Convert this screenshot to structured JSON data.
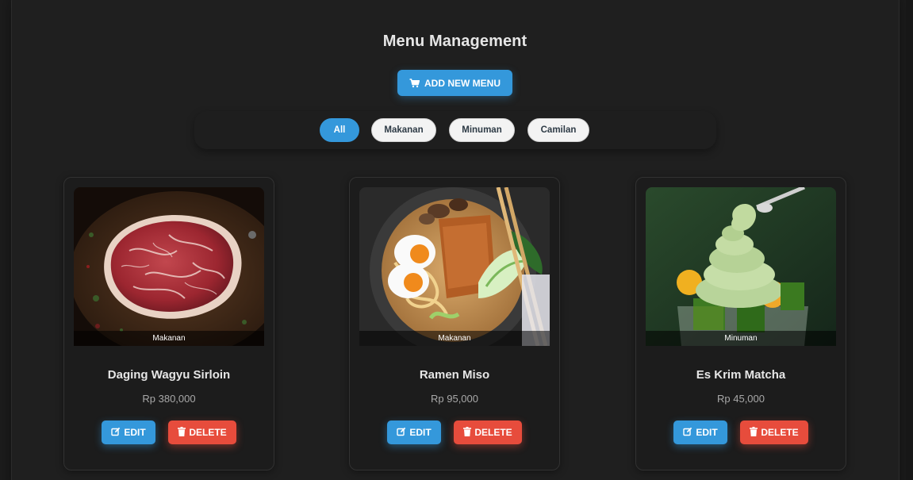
{
  "page": {
    "title": "Menu Management",
    "add_button_label": "ADD NEW MENU"
  },
  "filters": [
    {
      "label": "All",
      "active": true
    },
    {
      "label": "Makanan",
      "active": false
    },
    {
      "label": "Minuman",
      "active": false
    },
    {
      "label": "Camilan",
      "active": false
    }
  ],
  "cards": [
    {
      "name": "Daging Wagyu Sirloin",
      "price": "Rp 380,000",
      "category": "Makanan",
      "edit_label": "EDIT",
      "delete_label": "DELETE",
      "image": "wagyu-steak-photo"
    },
    {
      "name": "Ramen Miso",
      "price": "Rp 95,000",
      "category": "Makanan",
      "edit_label": "EDIT",
      "delete_label": "DELETE",
      "image": "ramen-bowl-photo"
    },
    {
      "name": "Es Krim Matcha",
      "price": "Rp 45,000",
      "category": "Minuman",
      "edit_label": "EDIT",
      "delete_label": "DELETE",
      "image": "matcha-ice-cream-photo"
    }
  ],
  "icons": {
    "add": "cart-icon",
    "edit": "edit-icon",
    "delete": "trash-icon"
  },
  "colors": {
    "accent": "#3498db",
    "danger": "#e74c3c",
    "background": "#1f1f1f"
  }
}
